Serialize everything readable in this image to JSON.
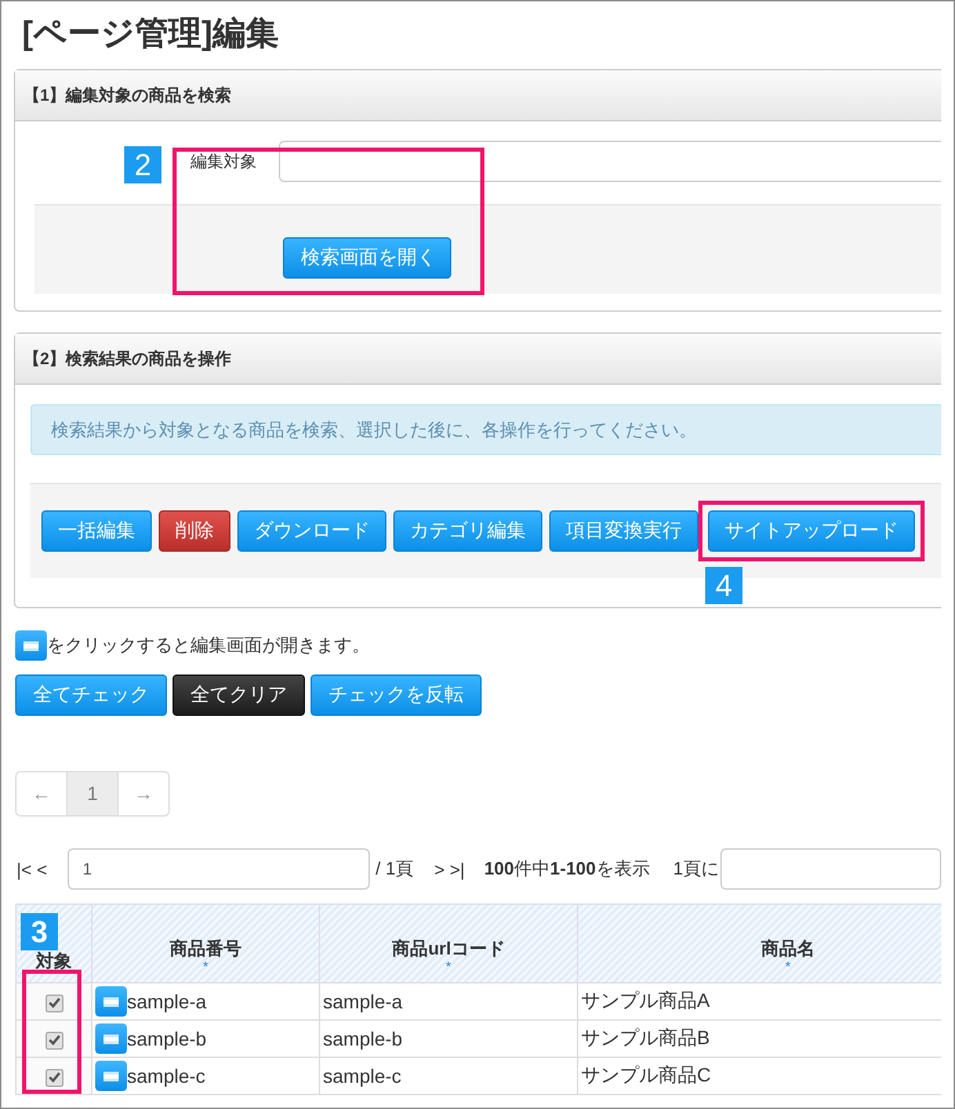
{
  "title": "[ページ管理]編集",
  "search_panel": {
    "heading": "【1】編集対象の商品を検索",
    "field_label": "編集対象",
    "button": "検索画面を開く",
    "callout": "2"
  },
  "operations_panel": {
    "heading": "【2】検索結果の商品を操作",
    "notice": "検索結果から対象となる商品を検索、選択した後に、各操作を行ってください。",
    "buttons": [
      {
        "label": "一括編集",
        "kind": "primary",
        "highlighted": false
      },
      {
        "label": "削除",
        "kind": "danger",
        "highlighted": false
      },
      {
        "label": "ダウンロード",
        "kind": "primary",
        "highlighted": false
      },
      {
        "label": "カテゴリ編集",
        "kind": "primary",
        "highlighted": false
      },
      {
        "label": "項目変換実行",
        "kind": "primary",
        "highlighted": false
      },
      {
        "label": "サイトアップロード",
        "kind": "primary",
        "highlighted": true
      }
    ],
    "callout": "4"
  },
  "hint": "をクリックすると編集画面が開きます。",
  "check_buttons": [
    {
      "label": "全てチェック",
      "kind": "primary"
    },
    {
      "label": "全てクリア",
      "kind": "dark"
    },
    {
      "label": "チェックを反転",
      "kind": "primary"
    }
  ],
  "pagination": {
    "prev": "←",
    "pages": [
      {
        "label": "1",
        "selected": true
      }
    ],
    "next": "→"
  },
  "pager": {
    "first": "|< <",
    "page_value": "1",
    "total": "/ 1頁",
    "last": "> >|",
    "summary": "**100**件中**1-100**を表示",
    "per_page_label": "1頁に"
  },
  "table": {
    "callout": "3",
    "columns": [
      {
        "label": "対象"
      },
      {
        "label": "商品番号",
        "sort_mark": "*"
      },
      {
        "label": "商品urlコード",
        "sort_mark": "*"
      },
      {
        "label": "商品名",
        "sort_mark": "*"
      }
    ],
    "rows": [
      {
        "checked": true,
        "number": "sample-a",
        "url_code": "sample-a",
        "name": "サンプル商品A"
      },
      {
        "checked": true,
        "number": "sample-b",
        "url_code": "sample-b",
        "name": "サンプル商品B"
      },
      {
        "checked": true,
        "number": "sample-c",
        "url_code": "sample-c",
        "name": "サンプル商品C"
      }
    ]
  }
}
